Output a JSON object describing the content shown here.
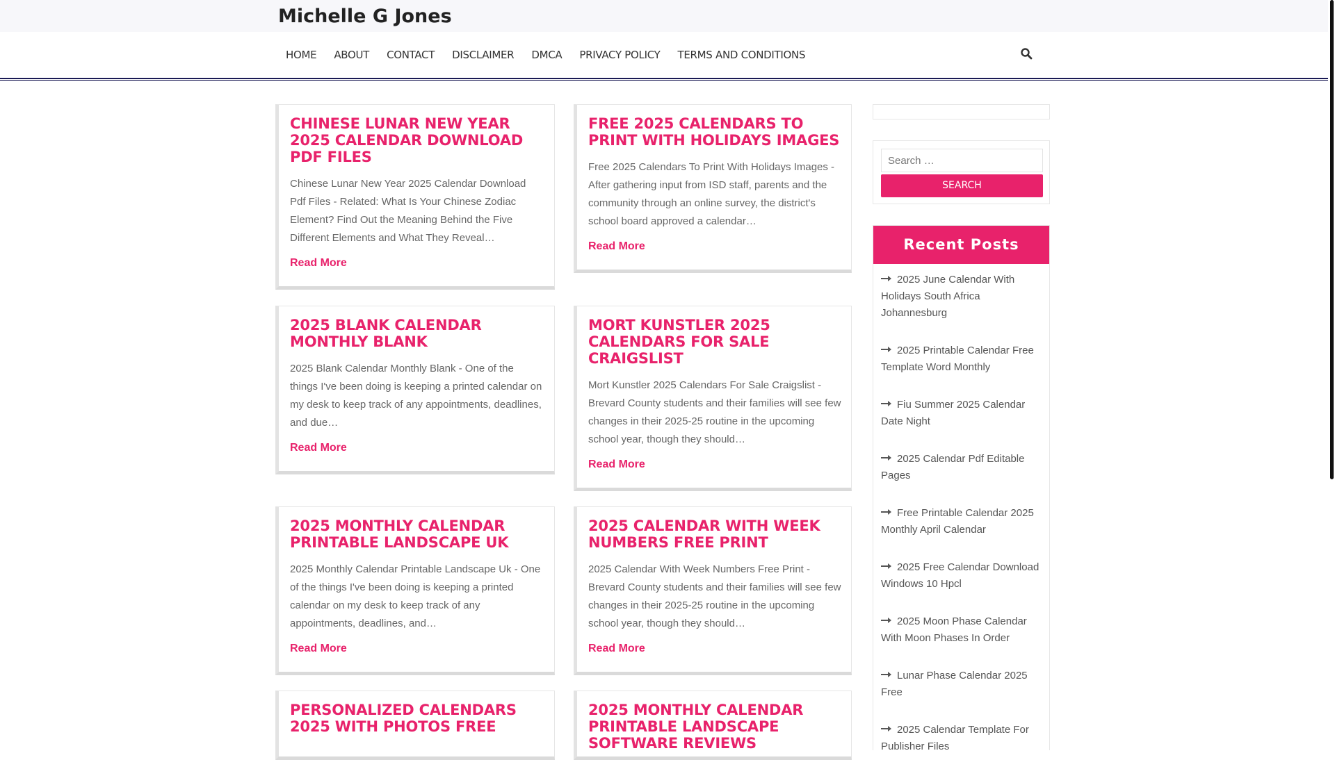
{
  "site": {
    "title": "Michelle G Jones"
  },
  "nav": {
    "items": [
      "HOME",
      "ABOUT",
      "CONTACT",
      "DISCLAIMER",
      "DMCA",
      "PRIVACY POLICY",
      "TERMS AND CONDITIONS"
    ],
    "search_icon": "search-icon"
  },
  "posts": [
    {
      "title": "CHINESE LUNAR NEW YEAR 2025 CALENDAR DOWNLOAD PDF FILES",
      "excerpt": "Chinese Lunar New Year 2025 Calendar Download Pdf Files - Related: What Is Your Chinese Zodiac Element? Find Out the Meaning Behind the Five Different Elements and What They Reveal…",
      "read_more": "Read More"
    },
    {
      "title": "FREE 2025 CALENDARS TO PRINT WITH HOLIDAYS IMAGES",
      "excerpt": "Free 2025 Calendars To Print With Holidays Images - After gathering input from ISD staff, parents and the community through an online survey, the district's school board approved a calendar…",
      "read_more": "Read More"
    },
    {
      "title": "2025 BLANK CALENDAR MONTHLY BLANK",
      "excerpt": "2025 Blank Calendar Monthly Blank - One of the things I've been doing is keeping a printed calendar on my desk to keep track of any appointments, deadlines, and due…",
      "read_more": "Read More"
    },
    {
      "title": "MORT KUNSTLER 2025 CALENDARS FOR SALE CRAIGSLIST",
      "excerpt": "Mort Kunstler 2025 Calendars For Sale Craigslist - Brevard County students and their families will see few changes in their 2025-25 routine in the upcoming school year, though they should…",
      "read_more": "Read More"
    },
    {
      "title": "2025 MONTHLY CALENDAR PRINTABLE LANDSCAPE UK",
      "excerpt": "2025 Monthly Calendar Printable Landscape Uk - One of the things I've been doing is keeping a printed calendar on my desk to keep track of any appointments, deadlines, and…",
      "read_more": "Read More"
    },
    {
      "title": "2025 CALENDAR WITH WEEK NUMBERS FREE PRINT",
      "excerpt": "2025 Calendar With Week Numbers Free Print - Brevard County students and their families will see few changes in their 2025-25 routine in the upcoming school year, though they should…",
      "read_more": "Read More"
    },
    {
      "title": "PERSONALIZED CALENDARS 2025 WITH PHOTOS FREE"
    },
    {
      "title": "2025 MONTHLY CALENDAR PRINTABLE LANDSCAPE SOFTWARE REVIEWS"
    }
  ],
  "sidebar": {
    "search": {
      "placeholder": "Search …",
      "button": "SEARCH"
    },
    "recent": {
      "heading": "Recent Posts",
      "items": [
        "2025 June Calendar With Holidays South Africa Johannesburg",
        "2025 Printable Calendar Free Template Word Monthly",
        "Fiu Summer 2025 Calendar Date Night",
        "2025 Calendar Pdf Editable Pages",
        "Free Printable Calendar 2025 Monthly April Calendar",
        "2025 Free Calendar Download Windows 10 Hpcl",
        "2025 Moon Phase Calendar With Moon Phases In Order",
        "Lunar Phase Calendar 2025 Free",
        "2025 Calendar Template For Publisher Files"
      ]
    }
  },
  "colors": {
    "accent": "#e8226b",
    "nav_border": "#1a1a55"
  }
}
